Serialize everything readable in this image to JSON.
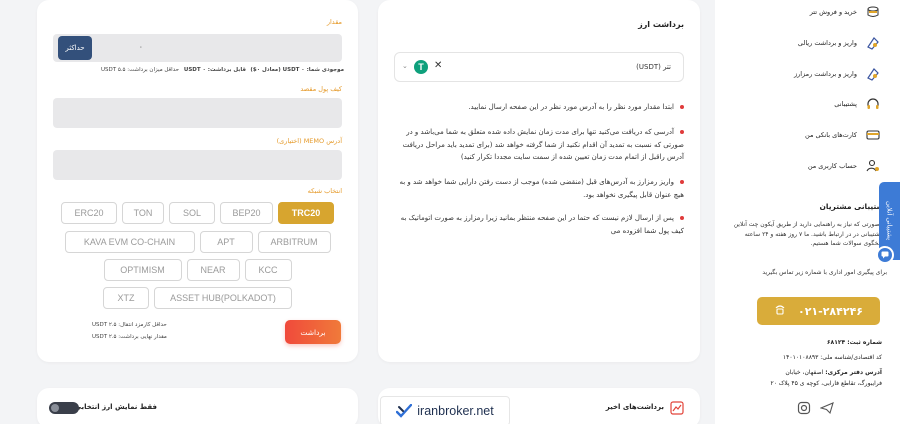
{
  "form": {
    "amount_label": "مقدار",
    "max_label": "حداکثر",
    "amount_value": "۰",
    "inventory": "موجودی شما: USDT ۰ (معادل ۰$)",
    "withdrawable": "قابل برداشت: USDT ۰",
    "min_amount": "حداقل میزان برداشت: USDT ۵.۵",
    "dest_wallet_label": "کیف پول مقصد",
    "memo_label": "آدرس MEMO (اختیاری)",
    "network_label": "انتخاب شبکه",
    "networks_row1": [
      "ERC20",
      "TON",
      "SOL",
      "BEP20",
      "TRC20"
    ],
    "networks_row2": [
      "KAVA EVM CO-CHAIN",
      "APT",
      "ARBITRUM"
    ],
    "networks_row3": [
      "OPTIMISM",
      "NEAR",
      "KCC"
    ],
    "networks_row4": [
      "XTZ",
      "ASSET HUB(POLKADOT)"
    ],
    "active_network": "TRC20",
    "fee": "حداقل کارمزد انتقال: USDT ۲.۵",
    "final_amount": "مقدار نهایی برداشت: USDT ۲.۵",
    "withdraw_button": "برداشت"
  },
  "info": {
    "title": "برداشت ارز",
    "coin_name": "تتر (USDT)",
    "coin_symbol": "T",
    "notes": [
      "ابتدا مقدار مورد نظر را به آدرس مورد نظر در این صفحه ارسال نمایید.",
      "آدرسی که دریافت می‌کنید تنها برای مدت زمان نمایش داده شده متعلق به شما می‌باشد و در صورتی که نسبت به تمدید آن اقدام نکنید از شما گرفته خواهد شد (برای تمدید باید مراحل دریافت آدرس را‌قبل از اتمام مدت زمان تعیین شده از سمت سایت مجددا تکرار کنید)",
      "واریز رمزارز به آدرس‌های قبل (منقضی شده) موجب از دست رفتن دارایی شما خواهد شد و به هیچ عنوان قابل پیگیری نخواهد بود.",
      "پس از ارسال لازم نیست که حتما در این صفحه منتظر بمانید زیرا رمزارز به صورت اتوماتیک به کیف پول شما افزوده می"
    ]
  },
  "sidebar": {
    "items": [
      {
        "label": "خرید و فروش تتر",
        "icon": "exchange-icon"
      },
      {
        "label": "واریز و برداشت ریالی",
        "icon": "rial-wallet-icon"
      },
      {
        "label": "واریز و برداشت رمزارز",
        "icon": "crypto-wallet-icon"
      },
      {
        "label": "پشتیبانی",
        "icon": "headset-icon"
      },
      {
        "label": "کارت‌های بانکی من",
        "icon": "bank-card-icon"
      },
      {
        "label": "حساب کاربری من",
        "icon": "user-settings-icon"
      }
    ],
    "support_title": "پشتیبانی مشتریان",
    "support_text": "در صورتی که نیاز به راهنمایی دارید از طریق آیکون چت آنلاین با پشتیبانی در در ارتباط باشید. ما ۷ روز هفته و ۲۴ ساعته پاسخگوی سوالات شما هستیم.",
    "support_text2": "برای پیگیری امور اداری با شماره زیر تماس بگیرید",
    "phone": "۰۲۱-۲۸۴۲۴۶",
    "reg_no": "شماره ثبت: ۶۸۱۲۴",
    "national_id": "کد اقتصادی/شناسه ملی: ۱۴۰۱۰۱۰۸۸۹۳",
    "address_label": "آدرس دفتر مرکزی:",
    "address_line1": "اصفهان، خیابان",
    "address_line2": "فرایبورگ، تقاطع فارابی، کوچه ی ۴۵ پلاک ۲۰",
    "online_tab": "پشتیبانی آنلاین"
  },
  "bottom": {
    "toggle_label": "فقط نمایش ارز انتخابی",
    "recent_title": "برداشت‌های اخیر",
    "logo_text": "iranbroker.net"
  },
  "colors": {
    "accent_gold": "#d7a52f",
    "withdraw_red": "#f04a3b",
    "label_orange": "#e59a2a",
    "max_button": "#33507b",
    "tether_green": "#0ea07c",
    "online_blue": "#3d7bd6"
  }
}
